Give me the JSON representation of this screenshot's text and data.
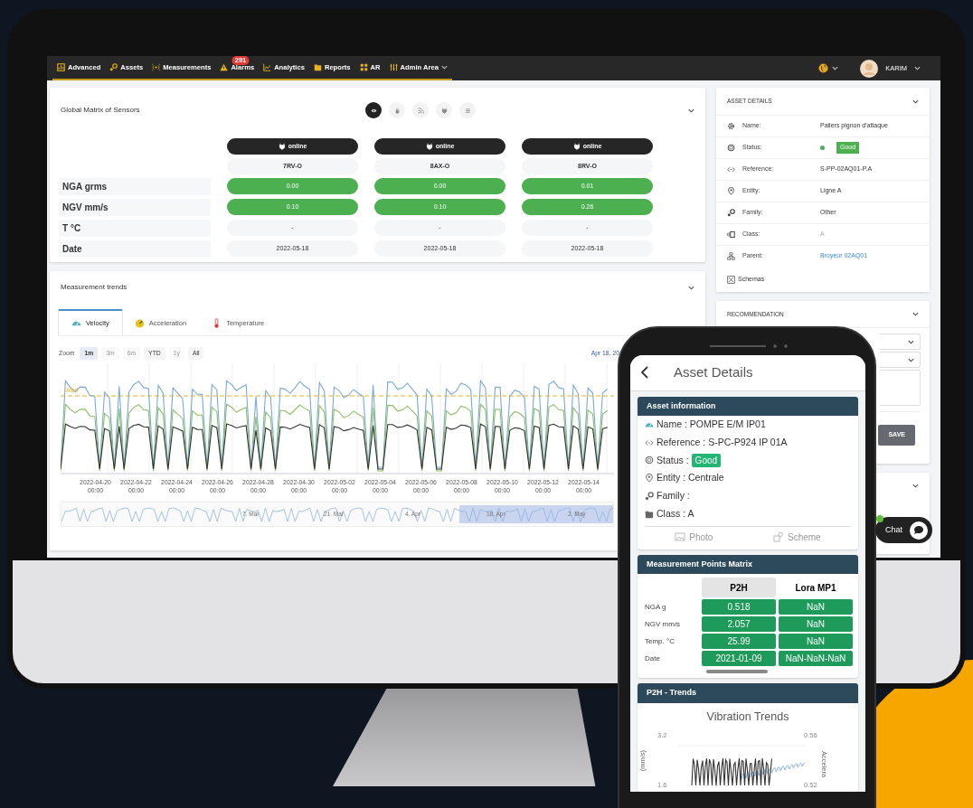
{
  "navbar": {
    "items": [
      {
        "label": "Advanced"
      },
      {
        "label": "Assets"
      },
      {
        "label": "Measurements"
      },
      {
        "label": "Alarms",
        "badge": "291"
      },
      {
        "label": "Analytics"
      },
      {
        "label": "Reports"
      },
      {
        "label": "AR"
      },
      {
        "label": "Admin Area",
        "dropdown": true
      }
    ],
    "user": "KARIM"
  },
  "sensor_matrix": {
    "title": "Global Matrix of Sensors",
    "view_buttons": [
      {
        "selected": true
      },
      {
        "selected": false
      },
      {
        "selected": false
      },
      {
        "selected": false
      },
      {
        "selected": false
      }
    ],
    "rows": [
      {
        "label": "NGA grms",
        "kind": "measure"
      },
      {
        "label": "NGV mm/s",
        "kind": "measure"
      },
      {
        "label": "T °C",
        "kind": "info"
      },
      {
        "label": "Date",
        "kind": "info"
      }
    ],
    "sensors": [
      {
        "status": "online",
        "name": "7RV-O",
        "values": [
          "0.00",
          "0.10",
          "-",
          "2022-05-18"
        ]
      },
      {
        "status": "online",
        "name": "8AX-O",
        "values": [
          "0.00",
          "0.10",
          "-",
          "2022-05-18"
        ]
      },
      {
        "status": "online",
        "name": "8RV-O",
        "values": [
          "0.01",
          "0.26",
          "-",
          "2022-05-18"
        ]
      }
    ]
  },
  "trends": {
    "title": "Measurement trends",
    "tabs": [
      {
        "label": "Velocity",
        "selected": true
      },
      {
        "label": "Acceleration",
        "selected": false
      },
      {
        "label": "Temperature",
        "selected": false
      }
    ],
    "zoom_label": "Zoom",
    "ranges": [
      {
        "label": "1m",
        "selected": true,
        "disabled": false
      },
      {
        "label": "3m",
        "selected": false,
        "disabled": true
      },
      {
        "label": "6m",
        "selected": false,
        "disabled": true
      },
      {
        "label": "YTD",
        "selected": false,
        "disabled": false
      },
      {
        "label": "1y",
        "selected": false,
        "disabled": true
      },
      {
        "label": "All",
        "selected": false,
        "disabled": false
      }
    ],
    "date_range": "Apr 18, 20",
    "alert_label": "Alert",
    "x_labels": [
      [
        "2022-04-20",
        "00:00"
      ],
      [
        "2022-04-22",
        "00:00"
      ],
      [
        "2022-04-24",
        "00:00"
      ],
      [
        "2022-04-26",
        "00:00"
      ],
      [
        "2022-04-28",
        "00:00"
      ],
      [
        "2022-04-30",
        "00:00"
      ],
      [
        "2022-05-02",
        "00:00"
      ],
      [
        "2022-05-04",
        "00:00"
      ],
      [
        "2022-05-06",
        "00:00"
      ],
      [
        "2022-05-08",
        "00:00"
      ],
      [
        "2022-05-10",
        "00:00"
      ],
      [
        "2022-05-12",
        "00:00"
      ],
      [
        "2022-05-14",
        "00:00"
      ]
    ],
    "navigator_labels": [
      "7. Mar",
      "21. Mar",
      "4. Apr",
      "18. Apr",
      "2. May"
    ]
  },
  "asset_details": {
    "title": "ASSET DETAILS",
    "rows": [
      {
        "label": "Name:",
        "value": "Paliers pignon d'attaque",
        "kind": "text"
      },
      {
        "label": "Status:",
        "value": "Good",
        "kind": "status"
      },
      {
        "label": "Reference:",
        "value": "S-PP-02AQ01-P.A",
        "kind": "text"
      },
      {
        "label": "Entity:",
        "value": "Ligne A",
        "kind": "text"
      },
      {
        "label": "Family:",
        "value": "Other",
        "kind": "text"
      },
      {
        "label": "Class:",
        "value": "A",
        "kind": "muted"
      },
      {
        "label": "Parent:",
        "value": "Broyeur 02AQ01",
        "kind": "link"
      }
    ],
    "footer": "Schemas"
  },
  "recommendation": {
    "title": "RECOMMENDATION",
    "save": "SAVE"
  },
  "chat": {
    "label": "Chat",
    "online": true
  },
  "phone": {
    "title": "Asset Details",
    "info_title": "Asset information",
    "info_lines": [
      {
        "text": "Name : POMPE E/M IP01",
        "kind": "text"
      },
      {
        "text": "Reference : S-PC-P924 IP 01A",
        "kind": "text"
      },
      {
        "text": "Status :",
        "badge": "Good",
        "kind": "status"
      },
      {
        "text": "Entity : Centrale",
        "kind": "text"
      },
      {
        "text": "Family :",
        "kind": "text"
      },
      {
        "text": "Class : A",
        "kind": "text"
      }
    ],
    "buttons": [
      {
        "label": "Photo"
      },
      {
        "label": "Scheme"
      }
    ],
    "matrix_title": "Measurement Points Matrix",
    "columns": [
      {
        "label": "P2H",
        "selected": true
      },
      {
        "label": "Lora MP1",
        "selected": false
      }
    ],
    "rows": [
      {
        "label": "NGA g",
        "values": [
          "0.518",
          "NaN"
        ]
      },
      {
        "label": "NGV mm/s",
        "values": [
          "2.057",
          "NaN"
        ]
      },
      {
        "label": "Temp. °C",
        "values": [
          "25.99",
          "NaN"
        ]
      },
      {
        "label": "Date",
        "values": [
          "2021-01-09",
          "NaN-NaN-NaN"
        ]
      }
    ],
    "trends_title": "P2H - Trends",
    "chart_title": "Vibration Trends",
    "left_ticks": [
      "3.2",
      "1.6"
    ],
    "right_ticks": [
      "0.56",
      "0.52"
    ],
    "left_axis": "(mm/s)",
    "right_axis": "Accelera"
  }
}
